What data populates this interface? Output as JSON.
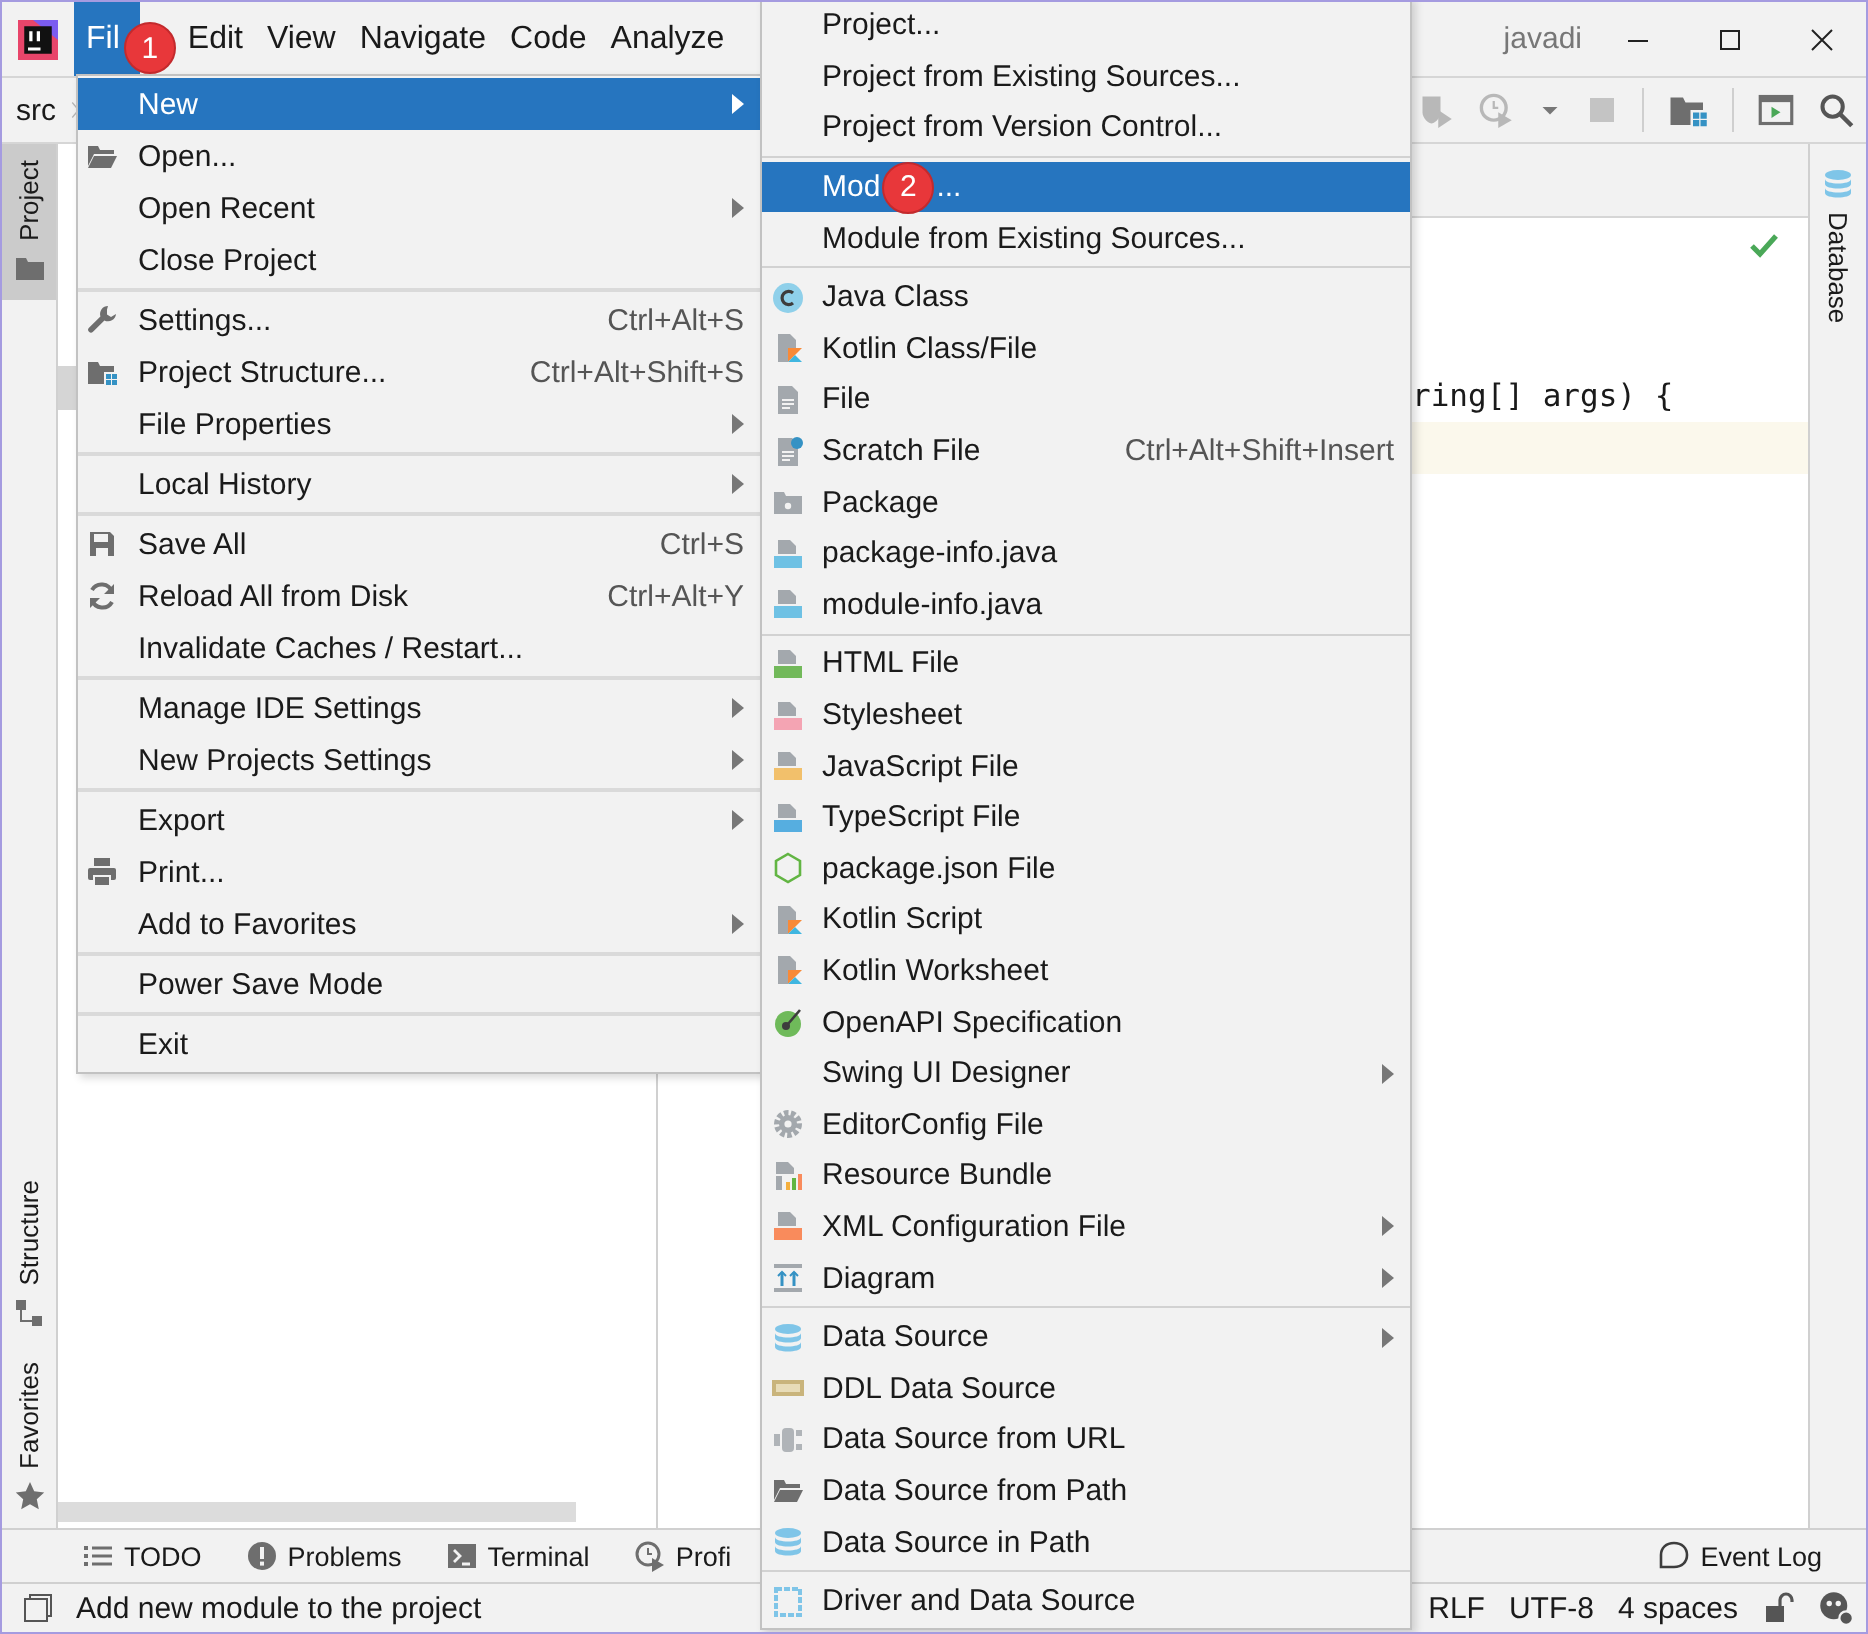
{
  "window": {
    "title": "javadi"
  },
  "menu_bar": [
    {
      "label": "Fil",
      "selected": true,
      "badge": "1"
    },
    {
      "label": "Edit",
      "selected": false
    },
    {
      "label": "View",
      "selected": false
    },
    {
      "label": "Navigate",
      "selected": false
    },
    {
      "label": "Code",
      "selected": false
    },
    {
      "label": "Analyze",
      "selected": false
    }
  ],
  "breadcrumb": "src",
  "left_strip": {
    "top": [
      {
        "label": "Project",
        "kind": "folder",
        "selected": true
      }
    ],
    "bottom": [
      {
        "label": "Structure",
        "kind": "structure",
        "selected": false
      },
      {
        "label": "Favorites",
        "kind": "star",
        "selected": false
      }
    ]
  },
  "right_strip": [
    {
      "label": "Database",
      "kind": "database",
      "selected": false
    }
  ],
  "editor": {
    "lines": [
      "ring[] args) {"
    ]
  },
  "file_menu": [
    {
      "kind": "item",
      "label": "New",
      "submenu": true,
      "selected": true
    },
    {
      "kind": "folder-open",
      "label": "Open...",
      "submenu": false,
      "selected": false
    },
    {
      "kind": "item",
      "label": "Open Recent",
      "submenu": true,
      "selected": false
    },
    {
      "kind": "item",
      "label": "Close Project",
      "submenu": false,
      "selected": false
    },
    {
      "kind": "separator"
    },
    {
      "kind": "wrench",
      "label": "Settings...",
      "shortcut": "Ctrl+Alt+S",
      "submenu": false,
      "selected": false
    },
    {
      "kind": "folder-grid",
      "label": "Project Structure...",
      "shortcut": "Ctrl+Alt+Shift+S",
      "submenu": false,
      "selected": false
    },
    {
      "kind": "item",
      "label": "File Properties",
      "submenu": true,
      "selected": false
    },
    {
      "kind": "separator"
    },
    {
      "kind": "item",
      "label": "Local History",
      "submenu": true,
      "selected": false
    },
    {
      "kind": "separator"
    },
    {
      "kind": "floppy",
      "label": "Save All",
      "shortcut": "Ctrl+S",
      "submenu": false,
      "selected": false
    },
    {
      "kind": "refresh",
      "label": "Reload All from Disk",
      "shortcut": "Ctrl+Alt+Y",
      "submenu": false,
      "selected": false
    },
    {
      "kind": "item",
      "label": "Invalidate Caches / Restart...",
      "submenu": false,
      "selected": false
    },
    {
      "kind": "separator"
    },
    {
      "kind": "item",
      "label": "Manage IDE Settings",
      "submenu": true,
      "selected": false
    },
    {
      "kind": "item",
      "label": "New Projects Settings",
      "submenu": true,
      "selected": false
    },
    {
      "kind": "separator"
    },
    {
      "kind": "item",
      "label": "Export",
      "submenu": true,
      "selected": false
    },
    {
      "kind": "printer",
      "label": "Print...",
      "submenu": false,
      "selected": false
    },
    {
      "kind": "item",
      "label": "Add to Favorites",
      "submenu": true,
      "selected": false
    },
    {
      "kind": "separator"
    },
    {
      "kind": "item",
      "label": "Power Save Mode",
      "submenu": false,
      "selected": false
    },
    {
      "kind": "separator"
    },
    {
      "kind": "item",
      "label": "Exit",
      "submenu": false,
      "selected": false
    }
  ],
  "new_submenu": [
    {
      "kind": "item",
      "label": "Project...",
      "submenu": false,
      "selected": false
    },
    {
      "kind": "item",
      "label": "Project from Existing Sources...",
      "submenu": false,
      "selected": false
    },
    {
      "kind": "item",
      "label": "Project from Version Control...",
      "submenu": false,
      "selected": false
    },
    {
      "kind": "separator"
    },
    {
      "kind": "item",
      "label": "Mod",
      "badge": "2",
      "label_after": "...",
      "submenu": false,
      "selected": true
    },
    {
      "kind": "item",
      "label": "Module from Existing Sources...",
      "submenu": false,
      "selected": false
    },
    {
      "kind": "separator"
    },
    {
      "kind": "java-class",
      "label": "Java Class",
      "submenu": false,
      "selected": false
    },
    {
      "kind": "kotlin",
      "label": "Kotlin Class/File",
      "submenu": false,
      "selected": false
    },
    {
      "kind": "file",
      "label": "File",
      "submenu": false,
      "selected": false
    },
    {
      "kind": "scratch",
      "label": "Scratch File",
      "shortcut": "Ctrl+Alt+Shift+Insert",
      "submenu": false,
      "selected": false
    },
    {
      "kind": "package",
      "label": "Package",
      "submenu": false,
      "selected": false
    },
    {
      "kind": "java-file",
      "label": "package-info.java",
      "submenu": false,
      "selected": false
    },
    {
      "kind": "java-file",
      "label": "module-info.java",
      "submenu": false,
      "selected": false
    },
    {
      "kind": "separator"
    },
    {
      "kind": "html",
      "label": "HTML File",
      "submenu": false,
      "selected": false
    },
    {
      "kind": "css",
      "label": "Stylesheet",
      "submenu": false,
      "selected": false
    },
    {
      "kind": "js",
      "label": "JavaScript File",
      "submenu": false,
      "selected": false
    },
    {
      "kind": "ts",
      "label": "TypeScript File",
      "submenu": false,
      "selected": false
    },
    {
      "kind": "json",
      "label": "package.json File",
      "submenu": false,
      "selected": false
    },
    {
      "kind": "kotlin",
      "label": "Kotlin Script",
      "submenu": false,
      "selected": false
    },
    {
      "kind": "kotlin",
      "label": "Kotlin Worksheet",
      "submenu": false,
      "selected": false
    },
    {
      "kind": "openapi",
      "label": "OpenAPI Specification",
      "submenu": false,
      "selected": false
    },
    {
      "kind": "item",
      "label": "Swing UI Designer",
      "submenu": true,
      "selected": false
    },
    {
      "kind": "gear",
      "label": "EditorConfig File",
      "submenu": false,
      "selected": false
    },
    {
      "kind": "bundle",
      "label": "Resource Bundle",
      "submenu": false,
      "selected": false
    },
    {
      "kind": "xml",
      "label": "XML Configuration File",
      "submenu": true,
      "selected": false
    },
    {
      "kind": "diagram",
      "label": "Diagram",
      "submenu": true,
      "selected": false
    },
    {
      "kind": "separator"
    },
    {
      "kind": "database",
      "label": "Data Source",
      "submenu": true,
      "selected": false
    },
    {
      "kind": "ddl",
      "label": "DDL Data Source",
      "submenu": false,
      "selected": false
    },
    {
      "kind": "url",
      "label": "Data Source from URL",
      "submenu": false,
      "selected": false
    },
    {
      "kind": "folder-open",
      "label": "Data Source from Path",
      "submenu": false,
      "selected": false
    },
    {
      "kind": "database",
      "label": "Data Source in Path",
      "submenu": false,
      "selected": false
    },
    {
      "kind": "separator"
    },
    {
      "kind": "driver",
      "label": "Driver and Data Source",
      "submenu": false,
      "selected": false
    }
  ],
  "tool_window_bar": {
    "left": [
      {
        "label": "TODO",
        "kind": "list"
      },
      {
        "label": "Problems",
        "kind": "problems"
      },
      {
        "label": "Terminal",
        "kind": "terminal"
      },
      {
        "label": "Profi",
        "kind": "profiler"
      }
    ],
    "right": [
      {
        "label": "Event Log",
        "kind": "balloon"
      }
    ]
  },
  "status_bar": {
    "message": "Add new module to the project",
    "indicators": [
      "RLF",
      "UTF-8",
      "4 spaces"
    ]
  }
}
